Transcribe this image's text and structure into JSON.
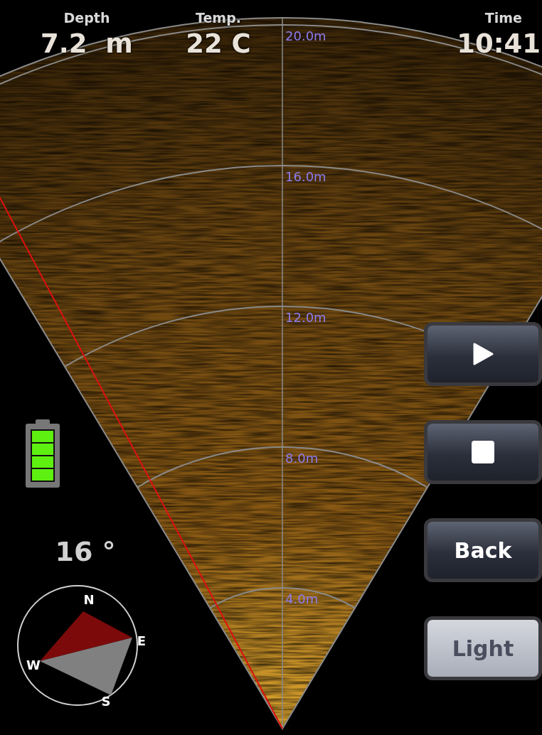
{
  "stats": [
    {
      "label": "Depth",
      "value": "7.2  m"
    },
    {
      "label": "Temp.",
      "value": "22 C"
    },
    {
      "label": "Time",
      "value": "10:41"
    }
  ],
  "sonar": {
    "range_labels": [
      "20.0m",
      "16.0m",
      "12.0m",
      "8.0m",
      "4.0m"
    ]
  },
  "heading": "16 °",
  "compass": {
    "letters": [
      "N",
      "E",
      "S",
      "W"
    ]
  },
  "buttons": [
    {
      "kind": "play",
      "on": false
    },
    {
      "kind": "stop",
      "on": false
    },
    {
      "kind": "text",
      "label": "Back",
      "on": false
    },
    {
      "kind": "text",
      "label": "Light",
      "on": true
    }
  ]
}
